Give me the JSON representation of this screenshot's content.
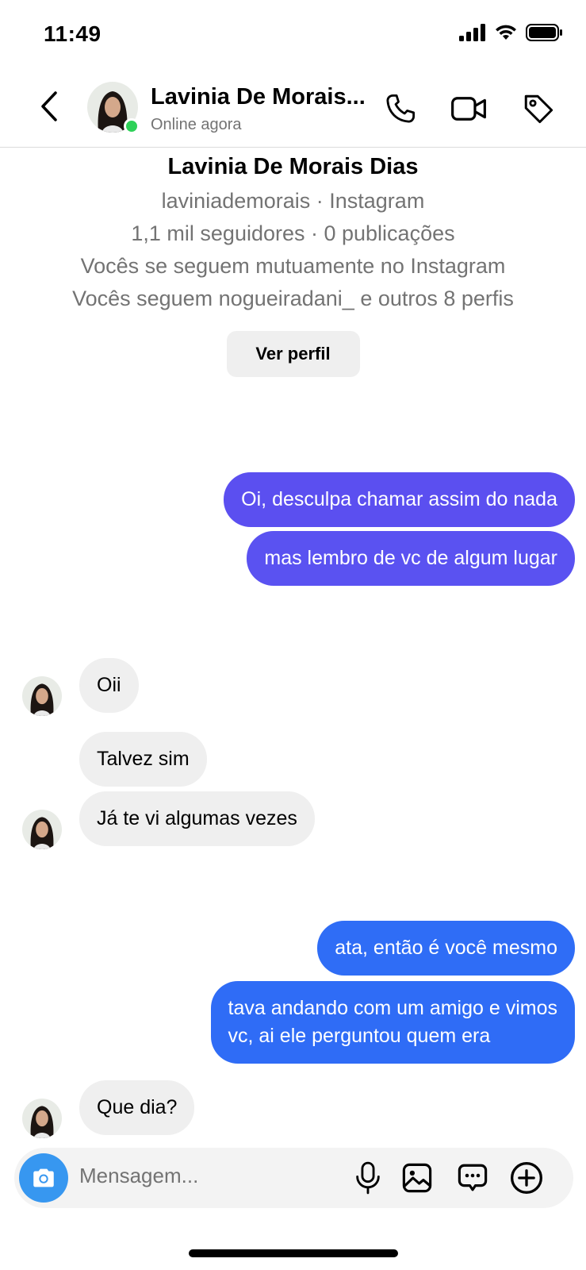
{
  "status_bar": {
    "time": "11:49"
  },
  "header": {
    "contact_name": "Lavinia De Morais...",
    "status": "Online agora"
  },
  "profile": {
    "name": "Lavinia De Morais Dias",
    "handle_line": "laviniademorais · Instagram",
    "stats_line": "1,1 mil seguidores · 0 publicações",
    "mutual_line": "Vocês se seguem mutuamente no Instagram",
    "follow_line": "Vocês seguem nogueiradani_ e outros 8 perfis",
    "view_profile_label": "Ver perfil"
  },
  "messages": [
    {
      "from": "me",
      "text": "Oi, desculpa chamar assim do nada"
    },
    {
      "from": "me",
      "text": "mas lembro de vc de algum lugar"
    },
    {
      "from": "them",
      "text": "Oii"
    },
    {
      "from": "them",
      "text": "Talvez sim"
    },
    {
      "from": "them",
      "text": "Já te vi algumas vezes"
    },
    {
      "from": "me",
      "text": "ata, então é você mesmo"
    },
    {
      "from": "me",
      "text": "tava andando com um amigo e vimos\nvc, ai ele perguntou quem era"
    },
    {
      "from": "them",
      "text": "Que dia?"
    }
  ],
  "composer": {
    "placeholder": "Mensagem..."
  },
  "colors": {
    "sent_purple": "#5b4ff0",
    "sent_blue": "#2f6df6",
    "online": "#2ed158",
    "camera": "#3797f0"
  }
}
